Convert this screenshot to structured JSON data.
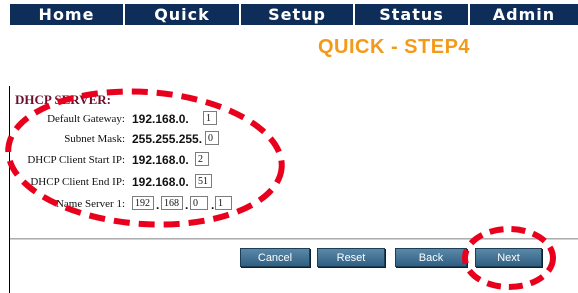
{
  "nav": {
    "items": [
      {
        "label": "Home"
      },
      {
        "label": "Quick"
      },
      {
        "label": "Setup"
      },
      {
        "label": "Status"
      },
      {
        "label": "Admin"
      }
    ]
  },
  "page": {
    "title": "QUICK - STEP4"
  },
  "dhcp": {
    "section_title": "DHCP SERVER:",
    "default_gateway": {
      "label": "Default Gateway:",
      "prefix": "192.168.0.",
      "value": "1"
    },
    "subnet_mask": {
      "label": "Subnet Mask:",
      "prefix": "255.255.255.",
      "value": "0"
    },
    "client_start_ip": {
      "label": "DHCP Client Start IP:",
      "prefix": "192.168.0.",
      "value": "2"
    },
    "client_end_ip": {
      "label": "DHCP Client End IP:",
      "prefix": "192.168.0.",
      "value": "51"
    },
    "name_server_1": {
      "label": "Name Server 1:",
      "octets": [
        "192",
        "168",
        "0",
        "1"
      ],
      "sep": "."
    }
  },
  "buttons": {
    "cancel": "Cancel",
    "reset": "Reset",
    "back": "Back",
    "next": "Next"
  },
  "colors": {
    "nav_background": "#0f2d59",
    "title": "#f39a1a",
    "section_title": "#6b0f2b",
    "annotation": "#e8001c",
    "button": "#3c6c8f"
  }
}
